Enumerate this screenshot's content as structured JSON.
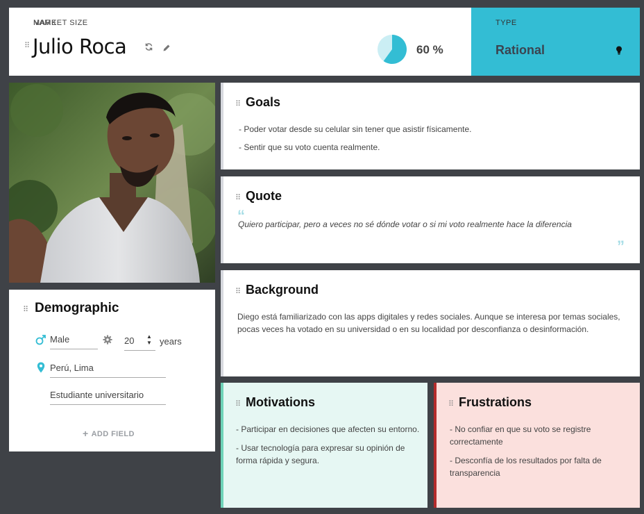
{
  "persona": {
    "name_label": "NAME",
    "name": "Julio Roca",
    "market_size_label": "MARKET SIZE",
    "market_size_value": "60 %",
    "market_size_fraction": 0.6,
    "type_label": "TYPE",
    "type_value": "Rational"
  },
  "colors": {
    "background": "#3f4247",
    "accent_teal": "#33bdd4",
    "motivations_bg": "#e6f7f3",
    "motivations_accent": "#6fd3b8",
    "frustrations_bg": "#fbe0dd",
    "frustrations_accent": "#b42b2b"
  },
  "icons": [
    "refresh-icon",
    "edit-icon",
    "lightbulb-icon",
    "male-icon",
    "gear-icon",
    "location-pin-icon",
    "quote-icon"
  ],
  "demographic": {
    "title": "Demographic",
    "gender": "Male",
    "age": "20",
    "age_unit": "years",
    "location": "Perú, Lima",
    "occupation": "Estudiante universitario",
    "add_field": "ADD FIELD"
  },
  "goals": {
    "title": "Goals",
    "items": [
      "-  Poder votar desde su celular sin tener que asistir físicamente.",
      "-  Sentir que su voto cuenta realmente."
    ]
  },
  "quote": {
    "title": "Quote",
    "text": "Quiero participar, pero a veces no sé dónde votar o si mi voto realmente hace la diferencia"
  },
  "background": {
    "title": "Background",
    "text": "Diego está familiarizado con las apps digitales y redes sociales. Aunque se interesa por temas sociales, pocas veces ha votado en su universidad o en su localidad por desconfianza o desinformación."
  },
  "motivations": {
    "title": "Motivations",
    "items": [
      "-  Participar en decisiones que afecten su entorno.",
      "-  Usar tecnología para expresar su opinión de forma rápida y segura."
    ]
  },
  "frustrations": {
    "title": "Frustrations",
    "items": [
      " - No confiar en que su voto se registre correctamente",
      "-  Desconfía de los resultados por falta de transparencia"
    ]
  }
}
